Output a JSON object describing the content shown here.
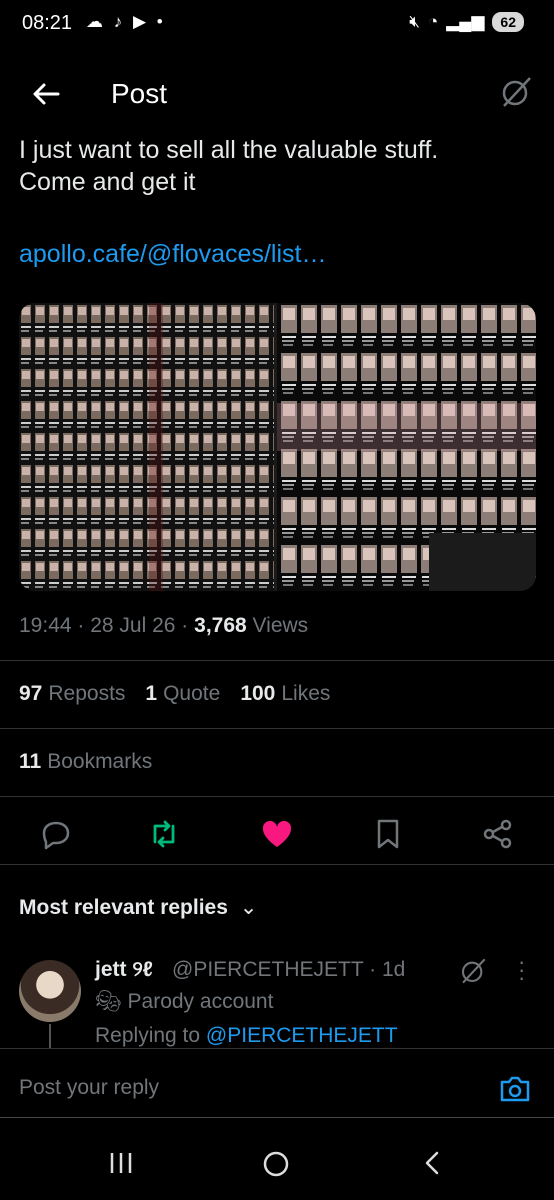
{
  "status_bar": {
    "time": "08:21",
    "battery": "62"
  },
  "header": {
    "title": "Post"
  },
  "tweet": {
    "text_line1": "I just want to sell all the valuable stuff.",
    "text_line2": "Come and get it",
    "link": "apollo.cafe/@flovaces/list…",
    "time": "19:44",
    "date": "28 Jul 26",
    "views_count": "3,768",
    "views_label": "Views",
    "reposts_count": "97",
    "reposts_label": "Reposts",
    "quotes_count": "1",
    "quotes_label": "Quote",
    "likes_count": "100",
    "likes_label": "Likes",
    "bookmarks_count": "11",
    "bookmarks_label": "Bookmarks"
  },
  "colors": {
    "accent": "#1d9bf0",
    "repost": "#00ba7c",
    "like": "#f91880"
  },
  "replies_header": "Most relevant replies",
  "reply": {
    "name": "jett ୨ℓ",
    "handle": "@PIERCETHEJETT · 1d",
    "parody": "Parody account",
    "replying_prefix": "Replying to",
    "replying_to": "@PIERCETHEJETT"
  },
  "composer": {
    "placeholder": "Post your reply"
  }
}
